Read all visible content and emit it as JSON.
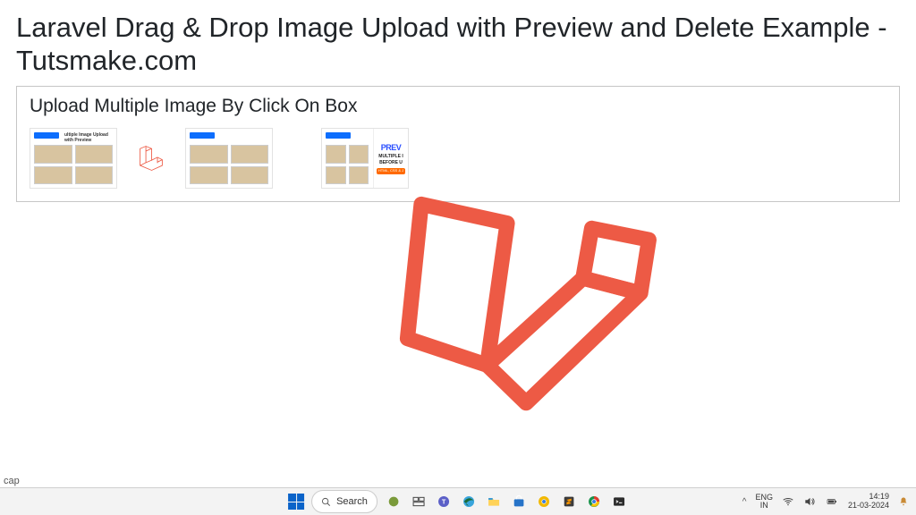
{
  "page": {
    "title": "Laravel Drag & Drop Image Upload with Preview and Delete Example - Tutsmake.com",
    "caption": "cap"
  },
  "card": {
    "heading": "Upload Multiple Image By Click On Box",
    "thumb_caption": "ultiple Image Upload with Preview",
    "preview_big": "PREV",
    "preview_l1": "MULTIPLE I",
    "preview_l2": "BEFORE U",
    "preview_tag": "HTML, CSS & J"
  },
  "taskbar": {
    "search_placeholder": "Search",
    "lang_top": "ENG",
    "lang_bottom": "IN",
    "time": "14:19",
    "date": "21-03-2024",
    "chevron": "^"
  },
  "colors": {
    "laravel": "#ed5a45",
    "accent": "#0d6efd"
  }
}
